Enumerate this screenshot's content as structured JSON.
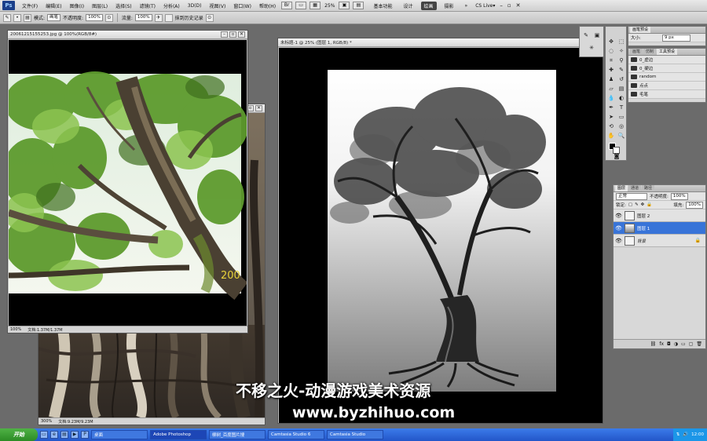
{
  "menubar": {
    "app_badge": "Ps",
    "items": [
      "文件(F)",
      "编辑(E)",
      "图像(I)",
      "图层(L)",
      "选择(S)",
      "滤镜(T)",
      "分析(A)",
      "3D(D)",
      "视图(V)",
      "窗口(W)",
      "帮助(H)"
    ],
    "zoom": "25%",
    "workspaces": [
      "基本功能",
      "设计",
      "绘画",
      "摄影"
    ],
    "active_workspace": "绘画",
    "cs_live": "CS Live▾"
  },
  "options": {
    "mode_label": "模式:",
    "mode_value": "画笔",
    "opacity_label": "不透明度:",
    "opacity_value": "100%",
    "flow_label": "流量:",
    "flow_value": "100%",
    "erase_history": "抹到历史记录"
  },
  "doc_photo": {
    "title": "20061215155253.jpg @ 100%(RGB/8#)",
    "status_zoom": "100%",
    "status_doc": "文档:1.37M/1.37M",
    "photo_date": "200"
  },
  "doc_back": {
    "status_zoom": "300%",
    "status_doc": "文档:9.23M/9.23M"
  },
  "doc_main": {
    "title": "未标题-1 @ 25% (图层 1, RGB/8) *"
  },
  "brush_panel": {
    "tabs": [
      "画笔预设"
    ],
    "size_label": "大小:",
    "size_value": "9 px"
  },
  "tool_presets": {
    "tabs": [
      "画笔",
      "仿制",
      "工具预设"
    ],
    "items": [
      "0_虚边",
      "0_硬边",
      "random",
      "点点",
      "毛笔"
    ]
  },
  "layers": {
    "tabs": [
      "图层",
      "通道",
      "路径"
    ],
    "blend_mode": "正常",
    "opacity_label": "不透明度:",
    "opacity_value": "100%",
    "lock_label": "锁定:",
    "fill_label": "填充:",
    "fill_value": "100%",
    "items": [
      {
        "name": "图层 2",
        "selected": false
      },
      {
        "name": "图层 1",
        "selected": true
      },
      {
        "name": "背景",
        "selected": false
      }
    ],
    "footer_icons": [
      "link-icon",
      "fx-icon",
      "mask-icon",
      "adjust-icon",
      "folder-icon",
      "new-layer-icon",
      "trash-icon"
    ]
  },
  "taskbar": {
    "start": "开始",
    "tasks": [
      "桌面",
      "Adobe Photoshop",
      "柳树_百度图片搜",
      "Camtasia Studio 6",
      "Camtasia Studio"
    ],
    "active_task": "Adobe Photoshop",
    "clock": "12:00"
  },
  "watermark": {
    "line1": "不移之火-动漫游戏美术资源",
    "line2": "www.byzhihuo.com"
  },
  "colors": {
    "selection": "#3874d8",
    "taskbar": "#2356c9",
    "start": "#2c8b25"
  }
}
